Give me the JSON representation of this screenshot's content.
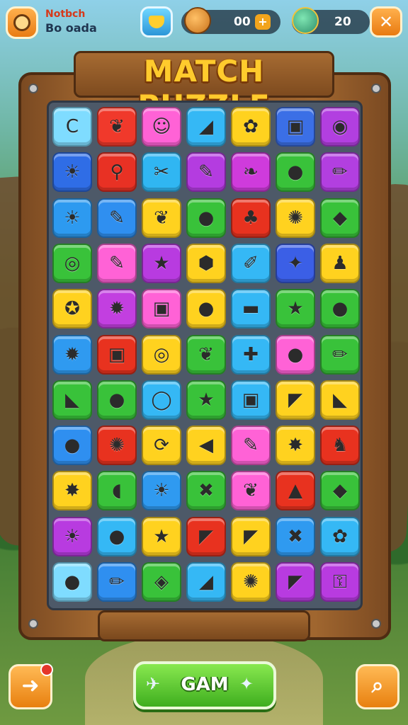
{
  "header": {
    "player_name_line1": "Notbch",
    "player_name_line2": "Bo oada",
    "coins_value": "00",
    "coins_add_label": "+",
    "gems_value": "20",
    "close_label": "✕"
  },
  "board": {
    "title": "MATCH PUZZLE",
    "columns": 7,
    "rows": 11,
    "tiles": [
      [
        {
          "color": "#7fdcff",
          "icon": "c-shape-icon",
          "glyph": "C"
        },
        {
          "color": "#f0392b",
          "icon": "leaf-icon",
          "glyph": "❦"
        },
        {
          "color": "#ff62d6",
          "icon": "face-icon",
          "glyph": "☺"
        },
        {
          "color": "#35b8f5",
          "icon": "wedge-icon",
          "glyph": "◢"
        },
        {
          "color": "#ffd21f",
          "icon": "fish-icon",
          "glyph": "✿"
        },
        {
          "color": "#3b6fe6",
          "icon": "robot-icon",
          "glyph": "▣"
        },
        {
          "color": "#b23fe0",
          "icon": "leaf-icon",
          "glyph": "◉"
        }
      ],
      [
        {
          "color": "#2f6de6",
          "icon": "sun-icon",
          "glyph": "☀"
        },
        {
          "color": "#e83124",
          "icon": "link-icon",
          "glyph": "⚲"
        },
        {
          "color": "#30b6f2",
          "icon": "wrench-icon",
          "glyph": "✂"
        },
        {
          "color": "#b43ce0",
          "icon": "bone-icon",
          "glyph": "✎"
        },
        {
          "color": "#cf3bdc",
          "icon": "bird-icon",
          "glyph": "❧"
        },
        {
          "color": "#39c23a",
          "icon": "drop-icon",
          "glyph": "●"
        },
        {
          "color": "#b23fe0",
          "icon": "pencil-icon",
          "glyph": "✏"
        }
      ],
      [
        {
          "color": "#2d9af0",
          "icon": "sun-icon",
          "glyph": "☀"
        },
        {
          "color": "#2f8ff0",
          "icon": "pencil-icon",
          "glyph": "✎"
        },
        {
          "color": "#ffd21f",
          "icon": "leaf-icon",
          "glyph": "❦"
        },
        {
          "color": "#39c23a",
          "icon": "orb-icon",
          "glyph": "●"
        },
        {
          "color": "#e8321f",
          "icon": "bug-icon",
          "glyph": "♣"
        },
        {
          "color": "#ffd21f",
          "icon": "flower-icon",
          "glyph": "✺"
        },
        {
          "color": "#39c23a",
          "icon": "card-icon",
          "glyph": "◆"
        }
      ],
      [
        {
          "color": "#39c23a",
          "icon": "pin-icon",
          "glyph": "◎"
        },
        {
          "color": "#ff62d6",
          "icon": "pencil-icon",
          "glyph": "✎"
        },
        {
          "color": "#b83be0",
          "icon": "star-icon",
          "glyph": "★"
        },
        {
          "color": "#ffd21f",
          "icon": "blob-icon",
          "glyph": "⬢"
        },
        {
          "color": "#35b8f5",
          "icon": "crayon-icon",
          "glyph": "✐"
        },
        {
          "color": "#3b5fe6",
          "icon": "sparkle-icon",
          "glyph": "✦"
        },
        {
          "color": "#ffd21f",
          "icon": "figure-icon",
          "glyph": "♟"
        }
      ],
      [
        {
          "color": "#ffd21f",
          "icon": "shoe-icon",
          "glyph": "✪"
        },
        {
          "color": "#c23fe0",
          "icon": "gear-icon",
          "glyph": "✹"
        },
        {
          "color": "#ff62d6",
          "icon": "robot-icon",
          "glyph": "▣"
        },
        {
          "color": "#ffd21f",
          "icon": "drop-icon",
          "glyph": "●"
        },
        {
          "color": "#35b8f5",
          "icon": "block-icon",
          "glyph": "▬"
        },
        {
          "color": "#39c23a",
          "icon": "star-icon",
          "glyph": "★"
        },
        {
          "color": "#39c23a",
          "icon": "orb-icon",
          "glyph": "●"
        }
      ],
      [
        {
          "color": "#2f9af0",
          "icon": "gear-icon",
          "glyph": "✹"
        },
        {
          "color": "#e8321f",
          "icon": "box-icon",
          "glyph": "▣"
        },
        {
          "color": "#ffd21f",
          "icon": "ring-icon",
          "glyph": "◎"
        },
        {
          "color": "#39c23a",
          "icon": "leaf-icon",
          "glyph": "❦"
        },
        {
          "color": "#35b8f5",
          "icon": "candy-icon",
          "glyph": "✚"
        },
        {
          "color": "#ff62d6",
          "icon": "drop-icon",
          "glyph": "●"
        },
        {
          "color": "#39c23a",
          "icon": "pencil-icon",
          "glyph": "✏"
        }
      ],
      [
        {
          "color": "#39c23a",
          "icon": "wedge-icon",
          "glyph": "◣"
        },
        {
          "color": "#39c23a",
          "icon": "orb-icon",
          "glyph": "●"
        },
        {
          "color": "#35b8f5",
          "icon": "ring-icon",
          "glyph": "◯"
        },
        {
          "color": "#39c23a",
          "icon": "star-icon",
          "glyph": "★"
        },
        {
          "color": "#35b8f5",
          "icon": "robot-icon",
          "glyph": "▣"
        },
        {
          "color": "#ffd21f",
          "icon": "shard-icon",
          "glyph": "◤"
        },
        {
          "color": "#ffd21f",
          "icon": "wedge-icon",
          "glyph": "◣"
        }
      ],
      [
        {
          "color": "#2f8ff0",
          "icon": "orb-icon",
          "glyph": "●"
        },
        {
          "color": "#e8321f",
          "icon": "flower-icon",
          "glyph": "✺"
        },
        {
          "color": "#ffd21f",
          "icon": "shell-icon",
          "glyph": "⟳"
        },
        {
          "color": "#ffd21f",
          "icon": "fin-icon",
          "glyph": "◀"
        },
        {
          "color": "#ff62d6",
          "icon": "pen-icon",
          "glyph": "✎"
        },
        {
          "color": "#ffd21f",
          "icon": "splat-icon",
          "glyph": "✸"
        },
        {
          "color": "#e8321f",
          "icon": "bird-icon",
          "glyph": "♞"
        }
      ],
      [
        {
          "color": "#ffd21f",
          "icon": "burst-icon",
          "glyph": "✸"
        },
        {
          "color": "#39c23a",
          "icon": "drop-icon",
          "glyph": "◖"
        },
        {
          "color": "#2f9af0",
          "icon": "sun-icon",
          "glyph": "☀"
        },
        {
          "color": "#39c23a",
          "icon": "cross-icon",
          "glyph": "✖"
        },
        {
          "color": "#ff62d6",
          "icon": "leaf-icon",
          "glyph": "❦"
        },
        {
          "color": "#e8321f",
          "icon": "gem-icon",
          "glyph": "▲"
        },
        {
          "color": "#39c23a",
          "icon": "leaf-icon",
          "glyph": "◆"
        }
      ],
      [
        {
          "color": "#b83be0",
          "icon": "sun-icon",
          "glyph": "☀"
        },
        {
          "color": "#35b8f5",
          "icon": "orb-icon",
          "glyph": "●"
        },
        {
          "color": "#ffd21f",
          "icon": "star-icon",
          "glyph": "★"
        },
        {
          "color": "#e8321f",
          "icon": "crayon-icon",
          "glyph": "◤"
        },
        {
          "color": "#ffd21f",
          "icon": "flag-icon",
          "glyph": "◤"
        },
        {
          "color": "#2f9af0",
          "icon": "cross-icon",
          "glyph": "✖"
        },
        {
          "color": "#35b8f5",
          "icon": "plant-icon",
          "glyph": "✿"
        }
      ],
      [
        {
          "color": "#7fdcff",
          "icon": "lemon-icon",
          "glyph": "●"
        },
        {
          "color": "#2f8ff0",
          "icon": "pencil-icon",
          "glyph": "✏"
        },
        {
          "color": "#39c23a",
          "icon": "pin-icon",
          "glyph": "◈"
        },
        {
          "color": "#35b8f5",
          "icon": "wedge-icon",
          "glyph": "◢"
        },
        {
          "color": "#ffd21f",
          "icon": "flower-icon",
          "glyph": "✺"
        },
        {
          "color": "#b83be0",
          "icon": "crayon-icon",
          "glyph": "◤"
        },
        {
          "color": "#b83be0",
          "icon": "key-icon",
          "glyph": "⚿"
        }
      ]
    ]
  },
  "footer": {
    "back_label": "➜",
    "game_button_label": "GAM",
    "search_label": "⌕"
  }
}
